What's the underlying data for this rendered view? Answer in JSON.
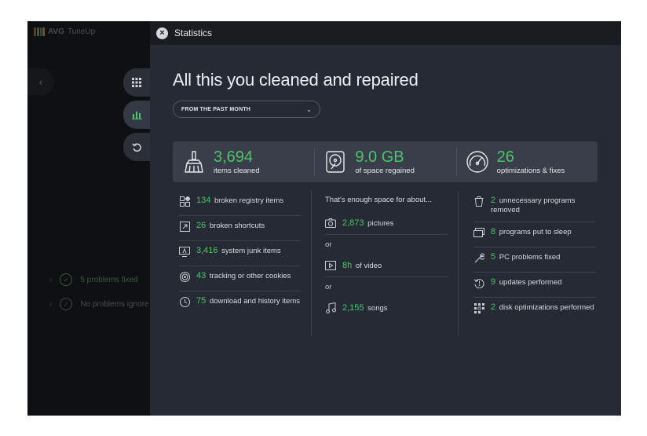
{
  "app": {
    "brand": "AVG",
    "product": "TuneUp"
  },
  "left": {
    "rows": [
      {
        "label": "5 problems fixed"
      },
      {
        "label": "No problems ignore"
      }
    ]
  },
  "panel": {
    "title": "Statistics",
    "heading": "All this you cleaned and repaired",
    "period": "FROM THE PAST MONTH"
  },
  "summary": [
    {
      "value": "3,694",
      "label": "items cleaned",
      "icon": "broom-icon"
    },
    {
      "value": "9.0 GB",
      "label": "of space regained",
      "icon": "hard-drive-icon"
    },
    {
      "value": "26",
      "label": "optimizations & fixes",
      "icon": "speedometer-icon"
    }
  ],
  "cleaned": [
    {
      "value": "134",
      "label": "broken registry items",
      "icon": "registry-icon"
    },
    {
      "value": "26",
      "label": "broken shortcuts",
      "icon": "shortcut-icon"
    },
    {
      "value": "3,416",
      "label": "system junk items",
      "icon": "junk-icon"
    },
    {
      "value": "43",
      "label": "tracking or other cookies",
      "icon": "tracking-icon"
    },
    {
      "value": "75",
      "label": "download and history items",
      "icon": "history-icon"
    }
  ],
  "space": {
    "intro": "That's enough space for about...",
    "or": "or",
    "items": [
      {
        "value": "2,873",
        "label": "pictures",
        "icon": "camera-icon"
      },
      {
        "value": "8h",
        "label": "of video",
        "icon": "video-icon"
      },
      {
        "value": "2,155",
        "label": "songs",
        "icon": "music-icon"
      }
    ]
  },
  "fixes": [
    {
      "value": "2",
      "label": "unnecessary programs removed",
      "icon": "trash-icon"
    },
    {
      "value": "8",
      "label": "programs put to sleep",
      "icon": "sleep-icon"
    },
    {
      "value": "5",
      "label": "PC problems fixed",
      "icon": "wrench-icon"
    },
    {
      "value": "9",
      "label": "updates performed",
      "icon": "update-icon"
    },
    {
      "value": "2",
      "label": "disk optimizations performed",
      "icon": "disk-optimize-icon"
    }
  ],
  "colors": {
    "accent_green": "#4cc56a",
    "panel_bg": "#262a34",
    "summary_bg": "#3a3e4a"
  }
}
